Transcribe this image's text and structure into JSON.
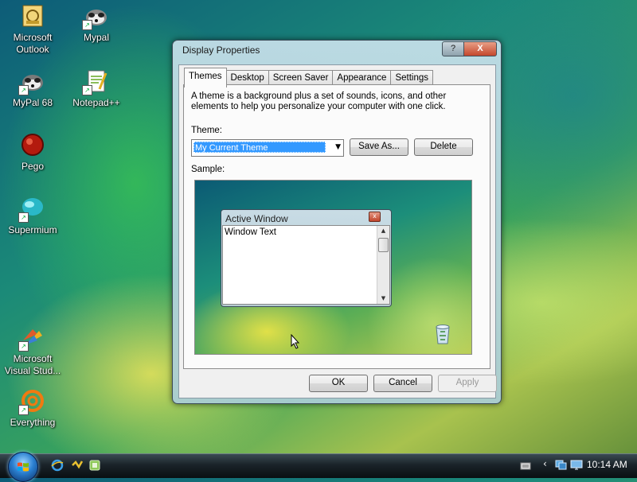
{
  "desktop": {
    "icons": [
      {
        "label_line1": "Microsoft",
        "label_line2": "Outlook"
      },
      {
        "label_line1": "Mypal",
        "label_line2": ""
      },
      {
        "label_line1": "MyPal 68",
        "label_line2": ""
      },
      {
        "label_line1": "Notepad++",
        "label_line2": ""
      },
      {
        "label_line1": "Pego",
        "label_line2": ""
      },
      {
        "label_line1": "Supermium",
        "label_line2": ""
      },
      {
        "label_line1": "Microsoft",
        "label_line2": "Visual Stud..."
      },
      {
        "label_line1": "Everything",
        "label_line2": ""
      }
    ]
  },
  "window": {
    "title": "Display Properties",
    "help_label": "?",
    "close_label": "X",
    "tabs": [
      {
        "label": "Themes",
        "active": true
      },
      {
        "label": "Desktop"
      },
      {
        "label": "Screen Saver"
      },
      {
        "label": "Appearance"
      },
      {
        "label": "Settings"
      }
    ],
    "description": "A theme is a background plus a set of sounds, icons, and other elements to help you personalize your computer with one click.",
    "theme_label": "Theme:",
    "theme_value": "My Current Theme",
    "save_as_label": "Save As...",
    "delete_label": "Delete",
    "sample_label": "Sample:",
    "sample": {
      "window_title": "Active Window",
      "window_text": "Window Text"
    },
    "ok_label": "OK",
    "cancel_label": "Cancel",
    "apply_label": "Apply"
  },
  "taskbar": {
    "clock": "10:14 AM",
    "quick_launch": [
      "ie-icon",
      "winamp-icon",
      "show-desktop-icon"
    ]
  }
}
